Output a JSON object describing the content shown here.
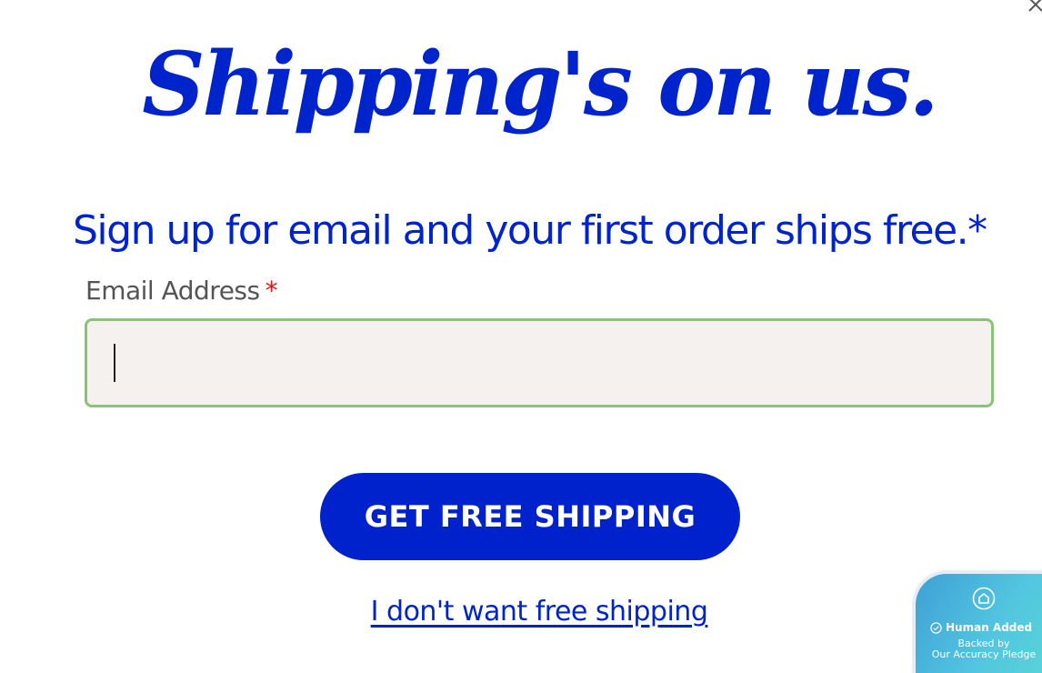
{
  "headline": "Shipping's on us.",
  "subheadline": "Sign up for email and your first order ships free.*",
  "email": {
    "label": "Email Address",
    "required_marker": "*",
    "value": "",
    "placeholder": ""
  },
  "cta_label": "GET FREE SHIPPING",
  "decline_label": "I don't want free shipping",
  "badge": {
    "title": "Human Added",
    "line1": "Backed by",
    "line2": "Our Accuracy Pledge"
  },
  "icons": {
    "close": "close-icon",
    "shield": "shield-icon",
    "check": "check-circle-icon"
  },
  "colors": {
    "brand_blue": "#0024cc",
    "button_blue": "#0022cc",
    "input_border": "#8bc27a",
    "input_bg": "#f4f1ee",
    "required_red": "#e01414",
    "badge_gradient_start": "#3fa0d6",
    "badge_gradient_end": "#5ad6d6"
  }
}
